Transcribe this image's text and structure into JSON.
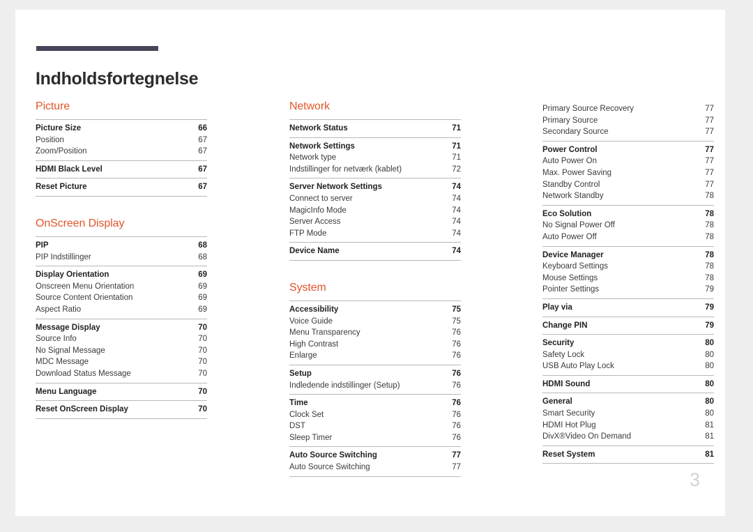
{
  "document": {
    "title": "Indholdsfortegnelse",
    "folio": "3",
    "accent_color": "#e0562a",
    "rule_color": "#474459",
    "text_color": "#3a3a3a"
  },
  "columns": [
    {
      "name": "column-1",
      "sections": [
        {
          "heading": "Picture",
          "groups": [
            {
              "entries": [
                {
                  "label": "Picture Size",
                  "page": "66",
                  "major": true
                },
                {
                  "label": "Position",
                  "page": "67",
                  "major": false
                },
                {
                  "label": "Zoom/Position",
                  "page": "67",
                  "major": false
                }
              ]
            },
            {
              "entries": [
                {
                  "label": "HDMI Black Level",
                  "page": "67",
                  "major": true
                }
              ]
            },
            {
              "entries": [
                {
                  "label": "Reset Picture",
                  "page": "67",
                  "major": true
                }
              ]
            }
          ]
        },
        {
          "heading": "OnScreen Display",
          "groups": [
            {
              "entries": [
                {
                  "label": "PIP",
                  "page": "68",
                  "major": true
                },
                {
                  "label": "PIP Indstillinger",
                  "page": "68",
                  "major": false
                }
              ]
            },
            {
              "entries": [
                {
                  "label": "Display Orientation",
                  "page": "69",
                  "major": true
                },
                {
                  "label": "Onscreen Menu Orientation",
                  "page": "69",
                  "major": false
                },
                {
                  "label": "Source Content Orientation",
                  "page": "69",
                  "major": false
                },
                {
                  "label": "Aspect Ratio",
                  "page": "69",
                  "major": false
                }
              ]
            },
            {
              "entries": [
                {
                  "label": "Message Display",
                  "page": "70",
                  "major": true
                },
                {
                  "label": "Source Info",
                  "page": "70",
                  "major": false
                },
                {
                  "label": "No Signal Message",
                  "page": "70",
                  "major": false
                },
                {
                  "label": "MDC Message",
                  "page": "70",
                  "major": false
                },
                {
                  "label": "Download Status Message",
                  "page": "70",
                  "major": false
                }
              ]
            },
            {
              "entries": [
                {
                  "label": "Menu Language",
                  "page": "70",
                  "major": true
                }
              ]
            },
            {
              "entries": [
                {
                  "label": "Reset OnScreen Display",
                  "page": "70",
                  "major": true
                }
              ]
            }
          ]
        }
      ]
    },
    {
      "name": "column-2",
      "sections": [
        {
          "heading": "Network",
          "groups": [
            {
              "entries": [
                {
                  "label": "Network Status",
                  "page": "71",
                  "major": true
                }
              ]
            },
            {
              "entries": [
                {
                  "label": "Network Settings",
                  "page": "71",
                  "major": true
                },
                {
                  "label": "Network type",
                  "page": "71",
                  "major": false
                },
                {
                  "label": "Indstillinger for netværk (kablet)",
                  "page": "72",
                  "major": false
                }
              ]
            },
            {
              "entries": [
                {
                  "label": "Server Network Settings",
                  "page": "74",
                  "major": true
                },
                {
                  "label": "Connect to server",
                  "page": "74",
                  "major": false
                },
                {
                  "label": "MagicInfo Mode",
                  "page": "74",
                  "major": false
                },
                {
                  "label": "Server Access",
                  "page": "74",
                  "major": false
                },
                {
                  "label": "FTP Mode",
                  "page": "74",
                  "major": false
                }
              ]
            },
            {
              "entries": [
                {
                  "label": "Device Name",
                  "page": "74",
                  "major": true
                }
              ]
            }
          ]
        },
        {
          "heading": "System",
          "groups": [
            {
              "entries": [
                {
                  "label": "Accessibility",
                  "page": "75",
                  "major": true
                },
                {
                  "label": "Voice Guide",
                  "page": "75",
                  "major": false
                },
                {
                  "label": "Menu Transparency",
                  "page": "76",
                  "major": false
                },
                {
                  "label": "High Contrast",
                  "page": "76",
                  "major": false
                },
                {
                  "label": "Enlarge",
                  "page": "76",
                  "major": false
                }
              ]
            },
            {
              "entries": [
                {
                  "label": "Setup",
                  "page": "76",
                  "major": true
                },
                {
                  "label": "Indledende indstillinger (Setup)",
                  "page": "76",
                  "major": false
                }
              ]
            },
            {
              "entries": [
                {
                  "label": "Time",
                  "page": "76",
                  "major": true
                },
                {
                  "label": "Clock Set",
                  "page": "76",
                  "major": false
                },
                {
                  "label": "DST",
                  "page": "76",
                  "major": false
                },
                {
                  "label": "Sleep Timer",
                  "page": "76",
                  "major": false
                }
              ]
            },
            {
              "entries": [
                {
                  "label": "Auto Source Switching",
                  "page": "77",
                  "major": true
                },
                {
                  "label": "Auto Source Switching",
                  "page": "77",
                  "major": false
                }
              ]
            }
          ]
        }
      ]
    },
    {
      "name": "column-3",
      "sections": [
        {
          "heading": "",
          "groups": [
            {
              "no_rule": true,
              "entries": [
                {
                  "label": "Primary Source Recovery",
                  "page": "77",
                  "major": false
                },
                {
                  "label": "Primary Source",
                  "page": "77",
                  "major": false
                },
                {
                  "label": "Secondary Source",
                  "page": "77",
                  "major": false
                }
              ]
            },
            {
              "entries": [
                {
                  "label": "Power Control",
                  "page": "77",
                  "major": true
                },
                {
                  "label": "Auto Power On",
                  "page": "77",
                  "major": false
                },
                {
                  "label": "Max. Power Saving",
                  "page": "77",
                  "major": false
                },
                {
                  "label": "Standby Control",
                  "page": "77",
                  "major": false
                },
                {
                  "label": "Network Standby",
                  "page": "78",
                  "major": false
                }
              ]
            },
            {
              "entries": [
                {
                  "label": "Eco Solution",
                  "page": "78",
                  "major": true
                },
                {
                  "label": "No Signal Power Off",
                  "page": "78",
                  "major": false
                },
                {
                  "label": "Auto Power Off",
                  "page": "78",
                  "major": false
                }
              ]
            },
            {
              "entries": [
                {
                  "label": "Device Manager",
                  "page": "78",
                  "major": true
                },
                {
                  "label": "Keyboard Settings",
                  "page": "78",
                  "major": false
                },
                {
                  "label": "Mouse Settings",
                  "page": "78",
                  "major": false
                },
                {
                  "label": "Pointer Settings",
                  "page": "79",
                  "major": false
                }
              ]
            },
            {
              "entries": [
                {
                  "label": "Play via",
                  "page": "79",
                  "major": true
                }
              ]
            },
            {
              "entries": [
                {
                  "label": "Change PIN",
                  "page": "79",
                  "major": true
                }
              ]
            },
            {
              "entries": [
                {
                  "label": "Security",
                  "page": "80",
                  "major": true
                },
                {
                  "label": "Safety Lock",
                  "page": "80",
                  "major": false
                },
                {
                  "label": "USB Auto Play Lock",
                  "page": "80",
                  "major": false
                }
              ]
            },
            {
              "entries": [
                {
                  "label": "HDMI Sound",
                  "page": "80",
                  "major": true
                }
              ]
            },
            {
              "entries": [
                {
                  "label": "General",
                  "page": "80",
                  "major": true
                },
                {
                  "label": "Smart Security",
                  "page": "80",
                  "major": false
                },
                {
                  "label": "HDMI Hot Plug",
                  "page": "81",
                  "major": false
                },
                {
                  "label": "DivX®Video On Demand",
                  "page": "81",
                  "major": false
                }
              ]
            },
            {
              "entries": [
                {
                  "label": "Reset System",
                  "page": "81",
                  "major": true
                }
              ]
            }
          ]
        }
      ]
    }
  ]
}
